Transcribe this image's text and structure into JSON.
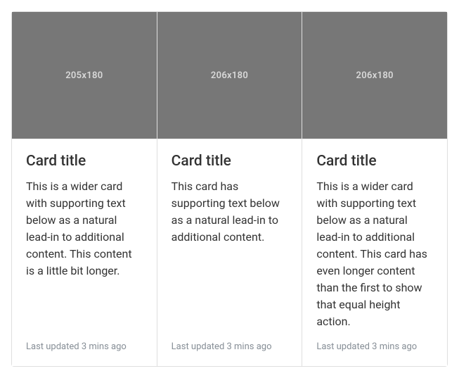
{
  "cards": [
    {
      "placeholder": "205x180",
      "title": "Card title",
      "text": "This is a wider card with supporting text below as a natural lead-in to additional content. This content is a little bit longer.",
      "updated": "Last updated 3 mins ago"
    },
    {
      "placeholder": "206x180",
      "title": "Card title",
      "text": "This card has supporting text below as a natural lead-in to additional content.",
      "updated": "Last updated 3 mins ago"
    },
    {
      "placeholder": "206x180",
      "title": "Card title",
      "text": "This is a wider card with supporting text below as a natural lead-in to additional content. This card has even longer content than the first to show that equal height action.",
      "updated": "Last updated 3 mins ago"
    }
  ]
}
